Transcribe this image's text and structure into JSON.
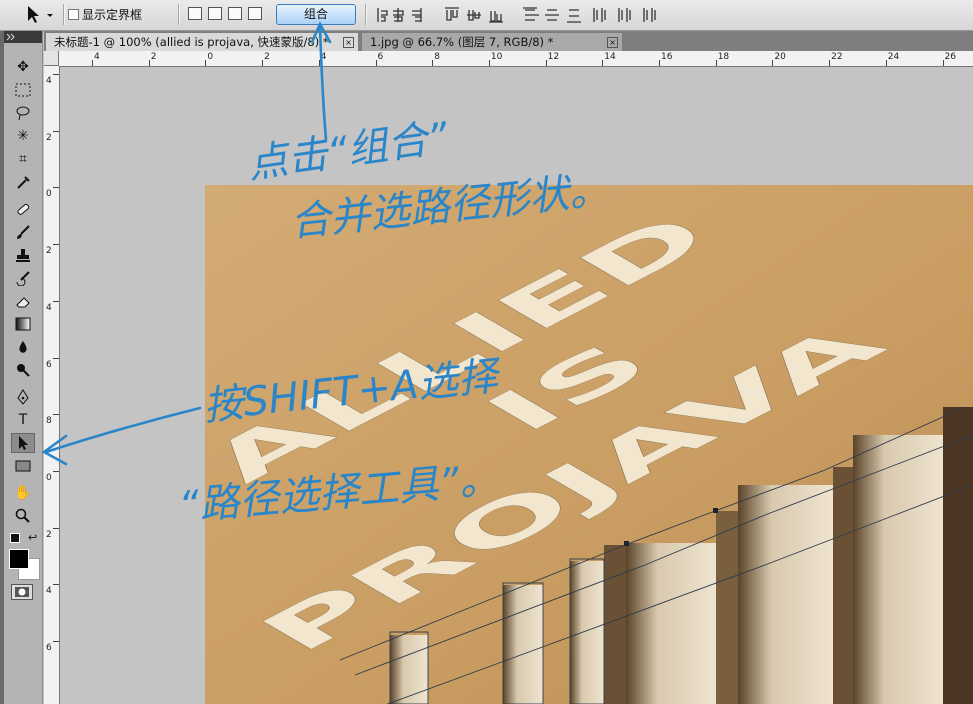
{
  "options_bar": {
    "show_bounds_label": "显示定界框",
    "combine_button_label": "组合"
  },
  "tabs": [
    {
      "label": "未标题-1 @ 100% (allied  is  projava, 快速蒙版/8) *",
      "close": "×"
    },
    {
      "label": "1.jpg @ 66.7% (图层 7, RGB/8) *",
      "close": "×"
    }
  ],
  "ruler_h": [
    "4",
    "2",
    "0",
    "2",
    "4",
    "6",
    "8",
    "10",
    "12",
    "14",
    "16",
    "18",
    "20",
    "22",
    "24",
    "26"
  ],
  "ruler_v": [
    "4",
    "2",
    "0",
    "2",
    "4",
    "6",
    "8",
    "0",
    "2",
    "4",
    "6"
  ],
  "canvas_text": [
    "ALLIED",
    "IS",
    "PROJAVA"
  ],
  "annotations": [
    {
      "text": "点击“组合”"
    },
    {
      "text": "合并选路径形状。"
    },
    {
      "text": "按SHIFT+A选择"
    },
    {
      "text": "“路径选择工具”。"
    }
  ],
  "colors": {
    "accent": "#1f78c8",
    "annotation": "#2a86c8",
    "paper": "#caa26a",
    "letters": "#f3e6cf"
  }
}
